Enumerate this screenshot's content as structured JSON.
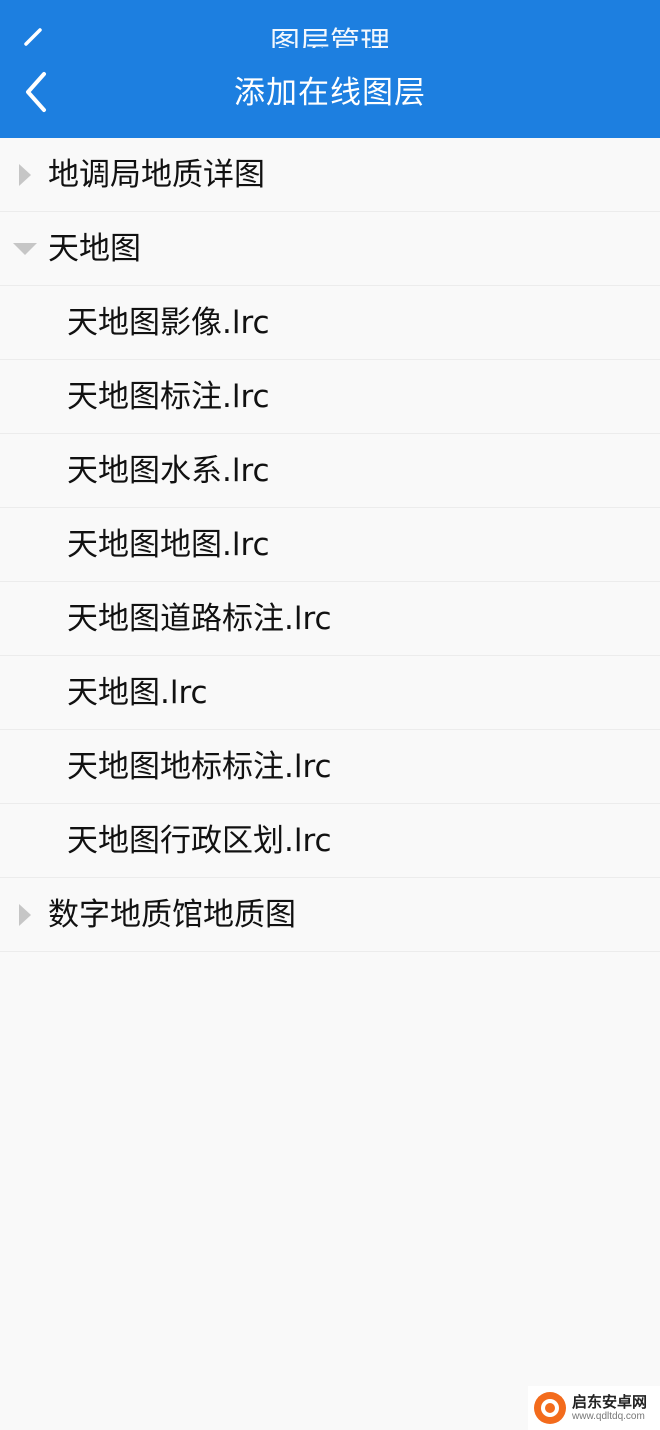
{
  "header": {
    "previous_title": "图层管理",
    "title": "添加在线图层",
    "back_icon": "chevron-left-icon",
    "bar_color": "#1d7fe0"
  },
  "tree": {
    "group_1": {
      "label": "地调局地质详图",
      "expanded": false
    },
    "group_2": {
      "label": "天地图",
      "expanded": true,
      "children": [
        "天地图影像.lrc",
        "天地图标注.lrc",
        "天地图水系.lrc",
        "天地图地图.lrc",
        "天地图道路标注.lrc",
        "天地图.lrc",
        "天地图地标标注.lrc",
        "天地图行政区划.lrc"
      ]
    },
    "group_3": {
      "label": "数字地质馆地质图",
      "expanded": false
    }
  },
  "watermark": {
    "name": "启东安卓网",
    "url": "www.qdltdq.com",
    "logo_color": "#f36b1c"
  }
}
